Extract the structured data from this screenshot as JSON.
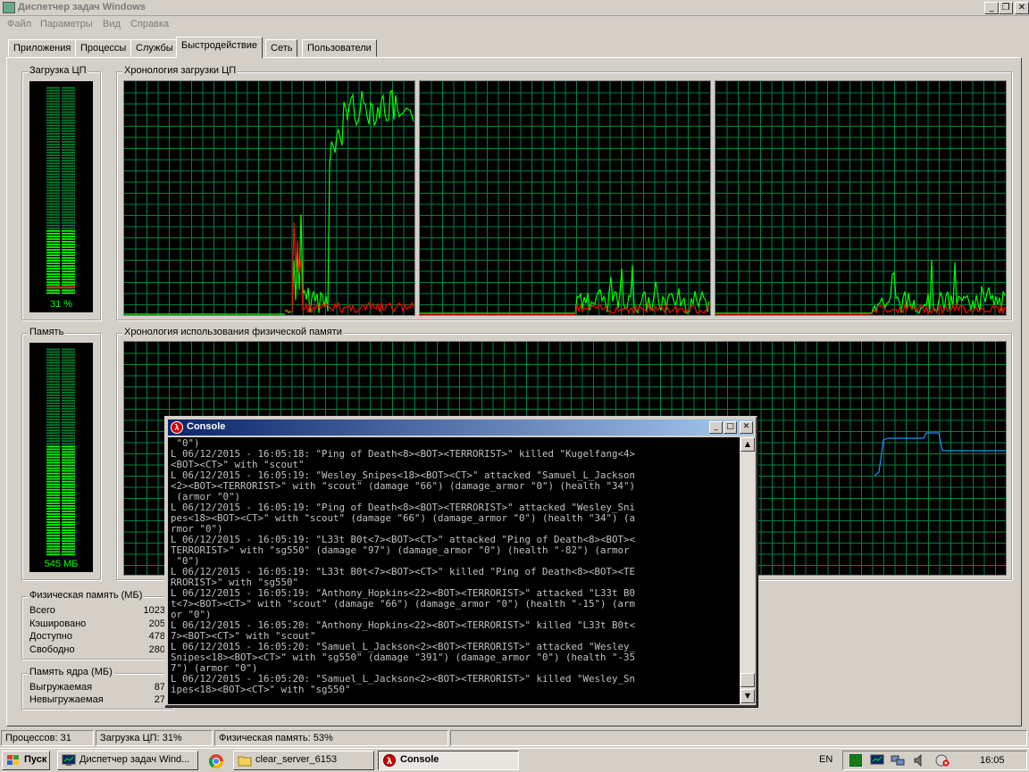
{
  "window": {
    "title": "Диспетчер задач Windows"
  },
  "menu": {
    "file": "Файл",
    "params": "Параметры",
    "view": "Вид",
    "help": "Справка"
  },
  "tabs": [
    "Приложения",
    "Процессы",
    "Службы",
    "Быстродействие",
    "Сеть",
    "Пользователи"
  ],
  "cpu": {
    "group_label": "Загрузка ЦП",
    "value_label": "31 %",
    "usage_percent": 31,
    "history_label": "Хронология загрузки ЦП"
  },
  "memory": {
    "group_label": "Память",
    "value_label": "545 МБ",
    "usage_fraction": 0.53,
    "history_label": "Хронология использования физической памяти"
  },
  "phys_mem": {
    "title": "Физическая память (МБ)",
    "rows": [
      {
        "label": "Всего",
        "value": "1023"
      },
      {
        "label": "Кэшировано",
        "value": "205"
      },
      {
        "label": "Доступно",
        "value": "478"
      },
      {
        "label": "Свободно",
        "value": "280"
      }
    ]
  },
  "kernel_mem": {
    "title": "Память ядра (МБ)",
    "rows": [
      {
        "label": "Выгружаемая",
        "value": "87"
      },
      {
        "label": "Невыгружаемая",
        "value": "27"
      }
    ]
  },
  "status": {
    "processes": "Процессов: 31",
    "cpu": "Загрузка ЦП: 31%",
    "memory": "Физическая память: 53%"
  },
  "console": {
    "title": "Console",
    "lines": [
      " \"0\")",
      "L 06/12/2015 - 16:05:18: \"Ping of Death<8><BOT><TERRORIST>\" killed \"Kugelfang<4>",
      "<BOT><CT>\" with \"scout\"",
      "L 06/12/2015 - 16:05:19: \"Wesley_Snipes<18><BOT><CT>\" attacked \"Samuel_L_Jackson",
      "<2><BOT><TERRORIST>\" with \"scout\" (damage \"66\") (damage_armor \"0\") (health \"34\")",
      " (armor \"0\")",
      "L 06/12/2015 - 16:05:19: \"Ping of Death<8><BOT><TERRORIST>\" attacked \"Wesley_Sni",
      "pes<18><BOT><CT>\" with \"scout\" (damage \"66\") (damage_armor \"0\") (health \"34\") (a",
      "rmor \"0\")",
      "L 06/12/2015 - 16:05:19: \"L33t B0t<7><BOT><CT>\" attacked \"Ping of Death<8><BOT><",
      "TERRORIST>\" with \"sg550\" (damage \"97\") (damage_armor \"0\") (health \"-82\") (armor",
      " \"0\")",
      "L 06/12/2015 - 16:05:19: \"L33t B0t<7><BOT><CT>\" killed \"Ping of Death<8><BOT><TE",
      "RRORIST>\" with \"sg550\"",
      "L 06/12/2015 - 16:05:19: \"Anthony_Hopkins<22><BOT><TERRORIST>\" attacked \"L33t B0",
      "t<7><BOT><CT>\" with \"scout\" (damage \"66\") (damage_armor \"0\") (health \"-15\") (arm",
      "or \"0\")",
      "L 06/12/2015 - 16:05:20: \"Anthony_Hopkins<22><BOT><TERRORIST>\" killed \"L33t B0t<",
      "7><BOT><CT>\" with \"scout\"",
      "L 06/12/2015 - 16:05:20: \"Samuel_L_Jackson<2><BOT><TERRORIST>\" attacked \"Wesley_",
      "Snipes<18><BOT><CT>\" with \"sg550\" (damage \"391\") (damage_armor \"0\") (health \"-35",
      "7\") (armor \"0\")",
      "L 06/12/2015 - 16:05:20: \"Samuel_L_Jackson<2><BOT><TERRORIST>\" killed \"Wesley_Sn",
      "ipes<18><BOT><CT>\" with \"sg550\""
    ]
  },
  "taskbar": {
    "start": "Пуск",
    "items": [
      "Диспетчер задач Wind...",
      "clear_server_6153",
      "Console"
    ],
    "lang": "EN",
    "clock": "16:05"
  },
  "colors": {
    "graph_grid": "#008040",
    "cpu_line": "#00ff00",
    "kernel_line": "#ff0000",
    "mem_line": "#1e90ff"
  }
}
